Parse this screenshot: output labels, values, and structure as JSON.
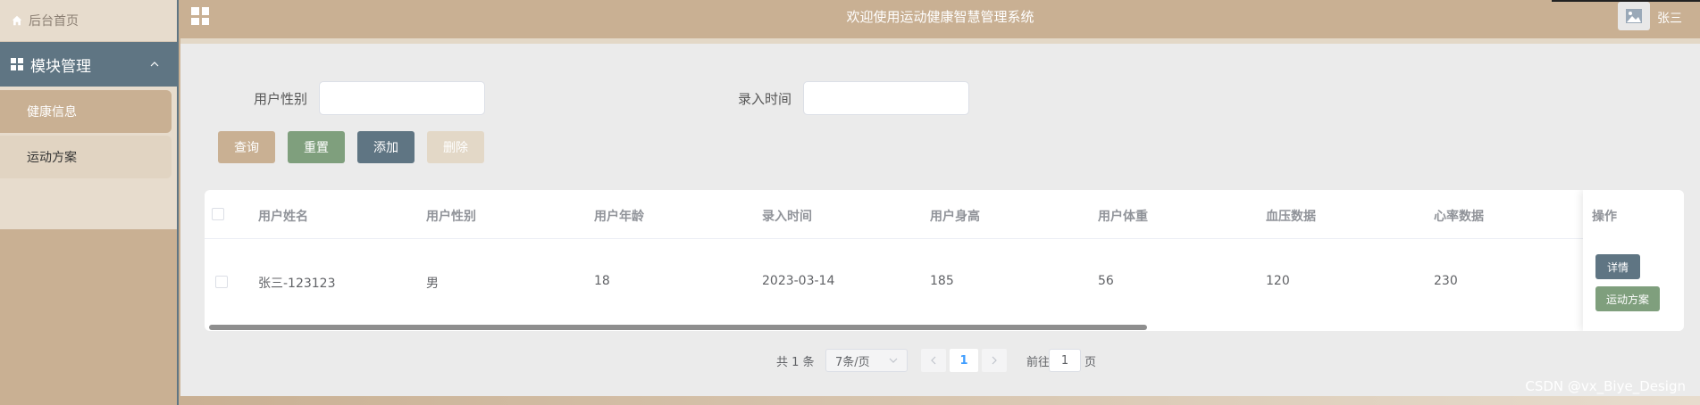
{
  "sidebar": {
    "home_label": "后台首页",
    "group_label": "模块管理",
    "items": [
      {
        "label": "健康信息",
        "active": true
      },
      {
        "label": "运动方案",
        "active": false
      }
    ]
  },
  "header": {
    "title": "欢迎使用运动健康智慧管理系统",
    "username": "张三"
  },
  "search": {
    "gender_label": "用户性别",
    "gender_value": "",
    "time_label": "录入时间",
    "time_value": ""
  },
  "buttons": {
    "query": "查询",
    "reset": "重置",
    "add": "添加",
    "delete": "删除"
  },
  "table": {
    "columns": [
      "用户姓名",
      "用户性别",
      "用户年龄",
      "录入时间",
      "用户身高",
      "用户体重",
      "血压数据",
      "心率数据",
      "操作"
    ],
    "rows": [
      {
        "name": "张三-123123",
        "gender": "男",
        "age": "18",
        "time": "2023-03-14",
        "height": "185",
        "weight": "56",
        "blood_pressure": "120",
        "heart_rate": "230",
        "detail_label": "详情",
        "plan_label": "运动方案"
      }
    ]
  },
  "pagination": {
    "total": "共 1 条",
    "page_size": "7条/页",
    "current_page": "1",
    "goto_label": "前往",
    "goto_value": "1",
    "page_suffix": "页"
  },
  "watermark": "CSDN @vx_Biye_Design",
  "colors": {
    "sidebar_bg": "#c9b093",
    "accent_slate": "#5f7583",
    "query_btn": "#c9b093",
    "reset_btn": "#7f9f7d",
    "add_btn": "#5f7583",
    "delete_btn": "#e3d8c7"
  }
}
